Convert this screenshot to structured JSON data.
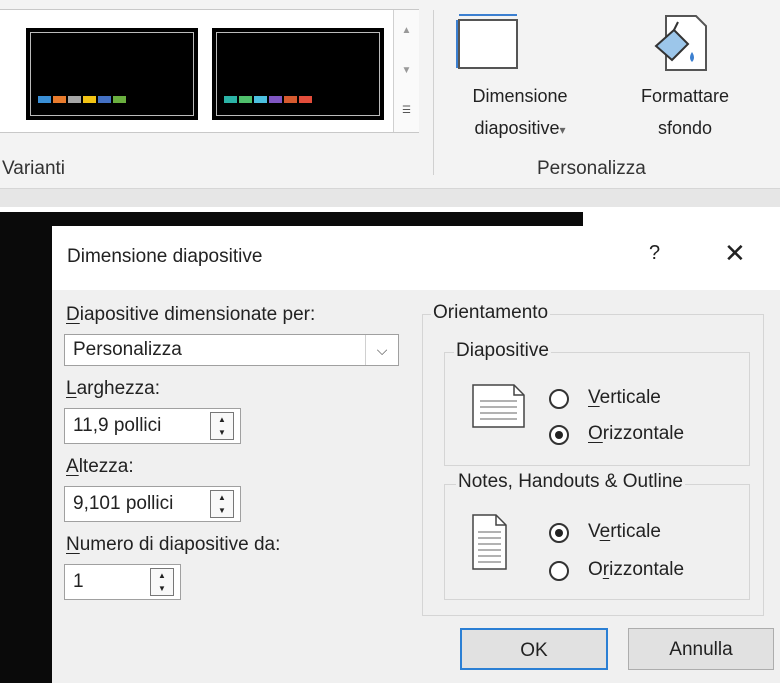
{
  "ribbon": {
    "variants_label": "Varianti",
    "customize_label": "Personalizza",
    "slide_size": {
      "line1": "Dimensione",
      "line2": "diapositive",
      "caret": "▾"
    },
    "format_bg": {
      "line1": "Formattare",
      "line2": "sfondo"
    },
    "thumb1_colors": [
      "#3a8fd6",
      "#e87b2d",
      "#a6a6a6",
      "#f2c314",
      "#4471c4",
      "#6aaf3f"
    ],
    "thumb2_colors": [
      "#2bb3a6",
      "#4fbf6b",
      "#4cc0e0",
      "#7f56c2",
      "#d65a2f",
      "#e34d3b"
    ]
  },
  "dialog": {
    "title": "Dimensione diapositive",
    "help": "?",
    "close": "✕",
    "sized_for_label": {
      "ul": "D",
      "rest": "iapositive dimensionate per:"
    },
    "sized_for_value": "Personalizza",
    "width_label": {
      "ul": "L",
      "rest": "arghezza:"
    },
    "width_value": "11,9 pollici",
    "height_label": {
      "ul": "A",
      "rest": "ltezza:"
    },
    "height_value": "9,101 pollici",
    "number_label": {
      "ul": "N",
      "rest": "umero di diapositive da:"
    },
    "number_value": "1",
    "orientation": "Orientamento",
    "slides_group": "Diapositive",
    "slides_portrait": {
      "ul": "V",
      "rest": "erticale"
    },
    "slides_landscape": {
      "ul": "O",
      "rest": "rizzontale"
    },
    "notes_group": "Notes, Handouts & Outline",
    "notes_portrait": {
      "pre": "V",
      "ul": "e",
      "rest": "rticale"
    },
    "notes_landscape": {
      "pre": "O",
      "ul": "r",
      "rest": "izzontale"
    },
    "ok": "OK",
    "cancel": "Annulla"
  }
}
